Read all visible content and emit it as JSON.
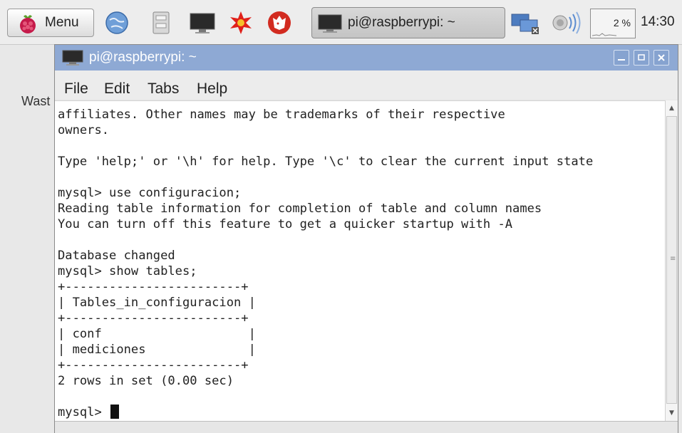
{
  "taskbar": {
    "menu_label": "Menu",
    "task_label": "pi@raspberrypi: ~",
    "cpu_label": "2 %",
    "clock": "14:30",
    "launchers": [
      "web-browser-icon",
      "file-manager-icon",
      "terminal-icon",
      "wolfram-icon",
      "mathematica-icon"
    ],
    "tray_icons": [
      "network-icon",
      "volume-icon"
    ]
  },
  "desktop": {
    "label": "Wast"
  },
  "window": {
    "title": "pi@raspberrypi: ~",
    "menu": [
      "File",
      "Edit",
      "Tabs",
      "Help"
    ],
    "controls": [
      "minimize",
      "maximize",
      "close"
    ]
  },
  "terminal": {
    "lines": [
      "affiliates. Other names may be trademarks of their respective",
      "owners.",
      "",
      "Type 'help;' or '\\h' for help. Type '\\c' to clear the current input state",
      "",
      "mysql> use configuracion;",
      "Reading table information for completion of table and column names",
      "You can turn off this feature to get a quicker startup with -A",
      "",
      "Database changed",
      "mysql> show tables;",
      "+------------------------+",
      "| Tables_in_configuracion |",
      "+------------------------+",
      "| conf                    |",
      "| mediciones              |",
      "+------------------------+",
      "2 rows in set (0.00 sec)",
      "",
      "mysql> "
    ]
  },
  "colors": {
    "titlebar": "#8ea9d4",
    "terminal_bg": "#ffffff",
    "terminal_fg": "#222222"
  }
}
